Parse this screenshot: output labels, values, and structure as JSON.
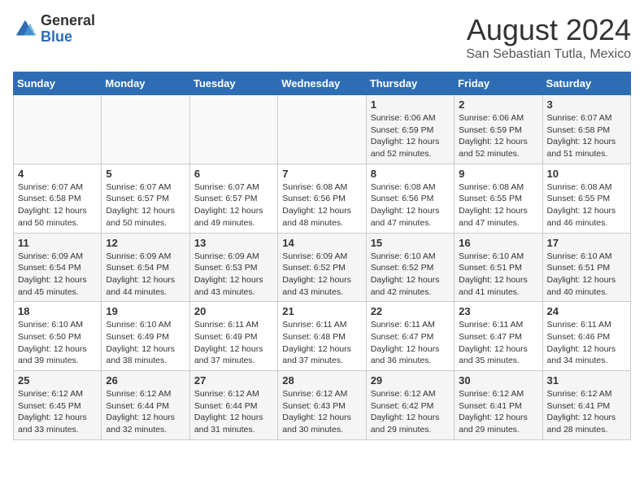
{
  "header": {
    "logo_general": "General",
    "logo_blue": "Blue",
    "title": "August 2024",
    "location": "San Sebastian Tutla, Mexico"
  },
  "days_of_week": [
    "Sunday",
    "Monday",
    "Tuesday",
    "Wednesday",
    "Thursday",
    "Friday",
    "Saturday"
  ],
  "weeks": [
    [
      {
        "day": "",
        "info": ""
      },
      {
        "day": "",
        "info": ""
      },
      {
        "day": "",
        "info": ""
      },
      {
        "day": "",
        "info": ""
      },
      {
        "day": "1",
        "info": "Sunrise: 6:06 AM\nSunset: 6:59 PM\nDaylight: 12 hours\nand 52 minutes."
      },
      {
        "day": "2",
        "info": "Sunrise: 6:06 AM\nSunset: 6:59 PM\nDaylight: 12 hours\nand 52 minutes."
      },
      {
        "day": "3",
        "info": "Sunrise: 6:07 AM\nSunset: 6:58 PM\nDaylight: 12 hours\nand 51 minutes."
      }
    ],
    [
      {
        "day": "4",
        "info": "Sunrise: 6:07 AM\nSunset: 6:58 PM\nDaylight: 12 hours\nand 50 minutes."
      },
      {
        "day": "5",
        "info": "Sunrise: 6:07 AM\nSunset: 6:57 PM\nDaylight: 12 hours\nand 50 minutes."
      },
      {
        "day": "6",
        "info": "Sunrise: 6:07 AM\nSunset: 6:57 PM\nDaylight: 12 hours\nand 49 minutes."
      },
      {
        "day": "7",
        "info": "Sunrise: 6:08 AM\nSunset: 6:56 PM\nDaylight: 12 hours\nand 48 minutes."
      },
      {
        "day": "8",
        "info": "Sunrise: 6:08 AM\nSunset: 6:56 PM\nDaylight: 12 hours\nand 47 minutes."
      },
      {
        "day": "9",
        "info": "Sunrise: 6:08 AM\nSunset: 6:55 PM\nDaylight: 12 hours\nand 47 minutes."
      },
      {
        "day": "10",
        "info": "Sunrise: 6:08 AM\nSunset: 6:55 PM\nDaylight: 12 hours\nand 46 minutes."
      }
    ],
    [
      {
        "day": "11",
        "info": "Sunrise: 6:09 AM\nSunset: 6:54 PM\nDaylight: 12 hours\nand 45 minutes."
      },
      {
        "day": "12",
        "info": "Sunrise: 6:09 AM\nSunset: 6:54 PM\nDaylight: 12 hours\nand 44 minutes."
      },
      {
        "day": "13",
        "info": "Sunrise: 6:09 AM\nSunset: 6:53 PM\nDaylight: 12 hours\nand 43 minutes."
      },
      {
        "day": "14",
        "info": "Sunrise: 6:09 AM\nSunset: 6:52 PM\nDaylight: 12 hours\nand 43 minutes."
      },
      {
        "day": "15",
        "info": "Sunrise: 6:10 AM\nSunset: 6:52 PM\nDaylight: 12 hours\nand 42 minutes."
      },
      {
        "day": "16",
        "info": "Sunrise: 6:10 AM\nSunset: 6:51 PM\nDaylight: 12 hours\nand 41 minutes."
      },
      {
        "day": "17",
        "info": "Sunrise: 6:10 AM\nSunset: 6:51 PM\nDaylight: 12 hours\nand 40 minutes."
      }
    ],
    [
      {
        "day": "18",
        "info": "Sunrise: 6:10 AM\nSunset: 6:50 PM\nDaylight: 12 hours\nand 39 minutes."
      },
      {
        "day": "19",
        "info": "Sunrise: 6:10 AM\nSunset: 6:49 PM\nDaylight: 12 hours\nand 38 minutes."
      },
      {
        "day": "20",
        "info": "Sunrise: 6:11 AM\nSunset: 6:49 PM\nDaylight: 12 hours\nand 37 minutes."
      },
      {
        "day": "21",
        "info": "Sunrise: 6:11 AM\nSunset: 6:48 PM\nDaylight: 12 hours\nand 37 minutes."
      },
      {
        "day": "22",
        "info": "Sunrise: 6:11 AM\nSunset: 6:47 PM\nDaylight: 12 hours\nand 36 minutes."
      },
      {
        "day": "23",
        "info": "Sunrise: 6:11 AM\nSunset: 6:47 PM\nDaylight: 12 hours\nand 35 minutes."
      },
      {
        "day": "24",
        "info": "Sunrise: 6:11 AM\nSunset: 6:46 PM\nDaylight: 12 hours\nand 34 minutes."
      }
    ],
    [
      {
        "day": "25",
        "info": "Sunrise: 6:12 AM\nSunset: 6:45 PM\nDaylight: 12 hours\nand 33 minutes."
      },
      {
        "day": "26",
        "info": "Sunrise: 6:12 AM\nSunset: 6:44 PM\nDaylight: 12 hours\nand 32 minutes."
      },
      {
        "day": "27",
        "info": "Sunrise: 6:12 AM\nSunset: 6:44 PM\nDaylight: 12 hours\nand 31 minutes."
      },
      {
        "day": "28",
        "info": "Sunrise: 6:12 AM\nSunset: 6:43 PM\nDaylight: 12 hours\nand 30 minutes."
      },
      {
        "day": "29",
        "info": "Sunrise: 6:12 AM\nSunset: 6:42 PM\nDaylight: 12 hours\nand 29 minutes."
      },
      {
        "day": "30",
        "info": "Sunrise: 6:12 AM\nSunset: 6:41 PM\nDaylight: 12 hours\nand 29 minutes."
      },
      {
        "day": "31",
        "info": "Sunrise: 6:12 AM\nSunset: 6:41 PM\nDaylight: 12 hours\nand 28 minutes."
      }
    ]
  ]
}
